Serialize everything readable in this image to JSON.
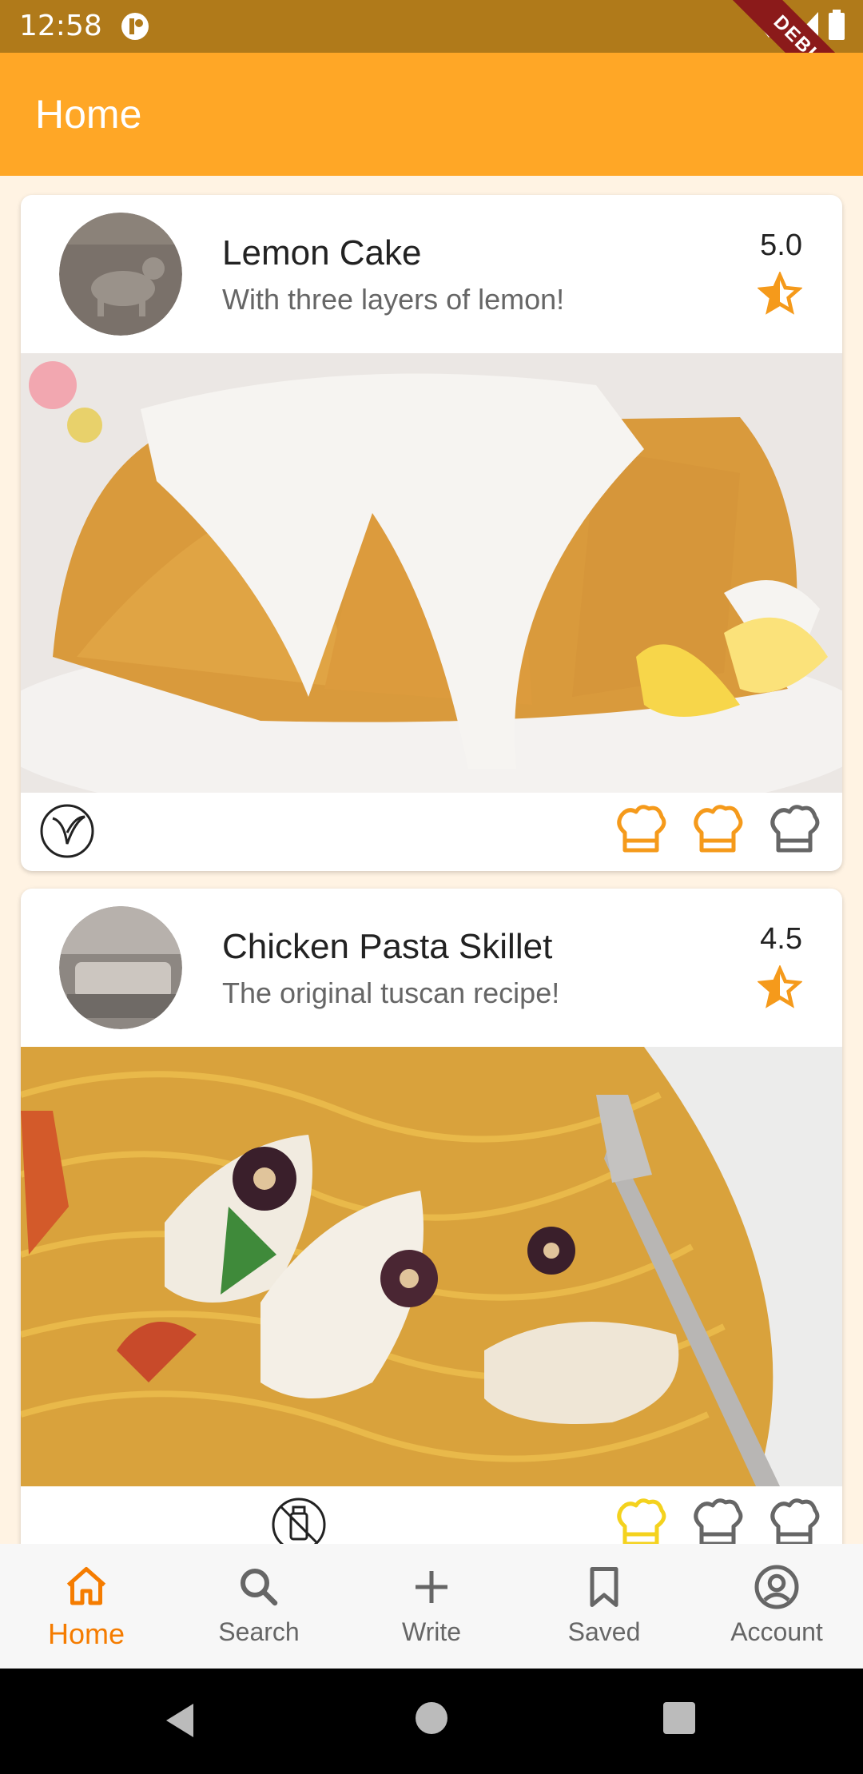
{
  "status_bar": {
    "time": "12:58",
    "debug_label": "DEBUG"
  },
  "app_bar": {
    "title": "Home"
  },
  "recipes": [
    {
      "title": "Lemon Cake",
      "subtitle": "With three layers of lemon!",
      "rating": "5.0",
      "diet_icon": "vegan-leaf-icon",
      "difficulty_filled": 2,
      "difficulty_total": 3
    },
    {
      "title": "Chicken Pasta Skillet",
      "subtitle": "The original tuscan recipe!",
      "rating": "4.5",
      "diet_icon": "dairy-free-icon",
      "difficulty_filled": 1,
      "difficulty_total": 3
    }
  ],
  "bottom_nav": {
    "items": [
      {
        "label": "Home",
        "icon": "home-icon",
        "active": true
      },
      {
        "label": "Search",
        "icon": "search-icon",
        "active": false
      },
      {
        "label": "Write",
        "icon": "plus-icon",
        "active": false
      },
      {
        "label": "Saved",
        "icon": "bookmark-icon",
        "active": false
      },
      {
        "label": "Account",
        "icon": "account-icon",
        "active": false
      }
    ]
  },
  "colors": {
    "accent": "#ffa726",
    "status_bar": "#b07a1a",
    "active_nav": "#f57c00",
    "chef_hat_filled_orange": "#f59a1b",
    "chef_hat_filled_yellow": "#f4d21e",
    "chef_hat_empty": "#666666"
  }
}
